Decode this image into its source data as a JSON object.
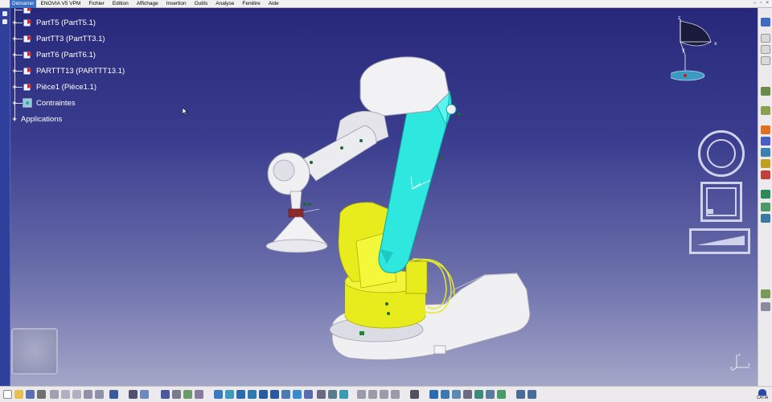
{
  "menu": {
    "start": "Démarrer",
    "items": [
      "ENOVIA V5 VPM",
      "Fichier",
      "Edition",
      "Affichage",
      "Insertion",
      "Outils",
      "Analyse",
      "Fenêtre",
      "Aide"
    ]
  },
  "tree": {
    "nodes": [
      {
        "label": "PartT5 (PartT5.1)",
        "icon": "part-icon"
      },
      {
        "label": "PartTT3 (PartTT3.1)",
        "icon": "part-icon"
      },
      {
        "label": "PartT6 (PartT6.1)",
        "icon": "part-icon"
      },
      {
        "label": "PARTTT13 (PARTTT13.1)",
        "icon": "part-icon"
      },
      {
        "label": "Pièce1 (Pièce1.1)",
        "icon": "part-icon"
      },
      {
        "label": "Contraintes",
        "icon": "constraints-icon"
      },
      {
        "label": "Applications",
        "icon": "none"
      }
    ]
  },
  "compass": {
    "x_label": "x",
    "y_label": "y",
    "z_label": "z"
  },
  "axis": {
    "x": "x",
    "y": "y",
    "z": "z"
  },
  "logo": {
    "text": "CATIA"
  },
  "colors": {
    "bg_top": "#27287a",
    "bg_bottom": "#a4a6c8",
    "robot_cyan": "#2ee8e0",
    "robot_yellow": "#e8ec1c",
    "robot_white": "#f0f0f2"
  }
}
